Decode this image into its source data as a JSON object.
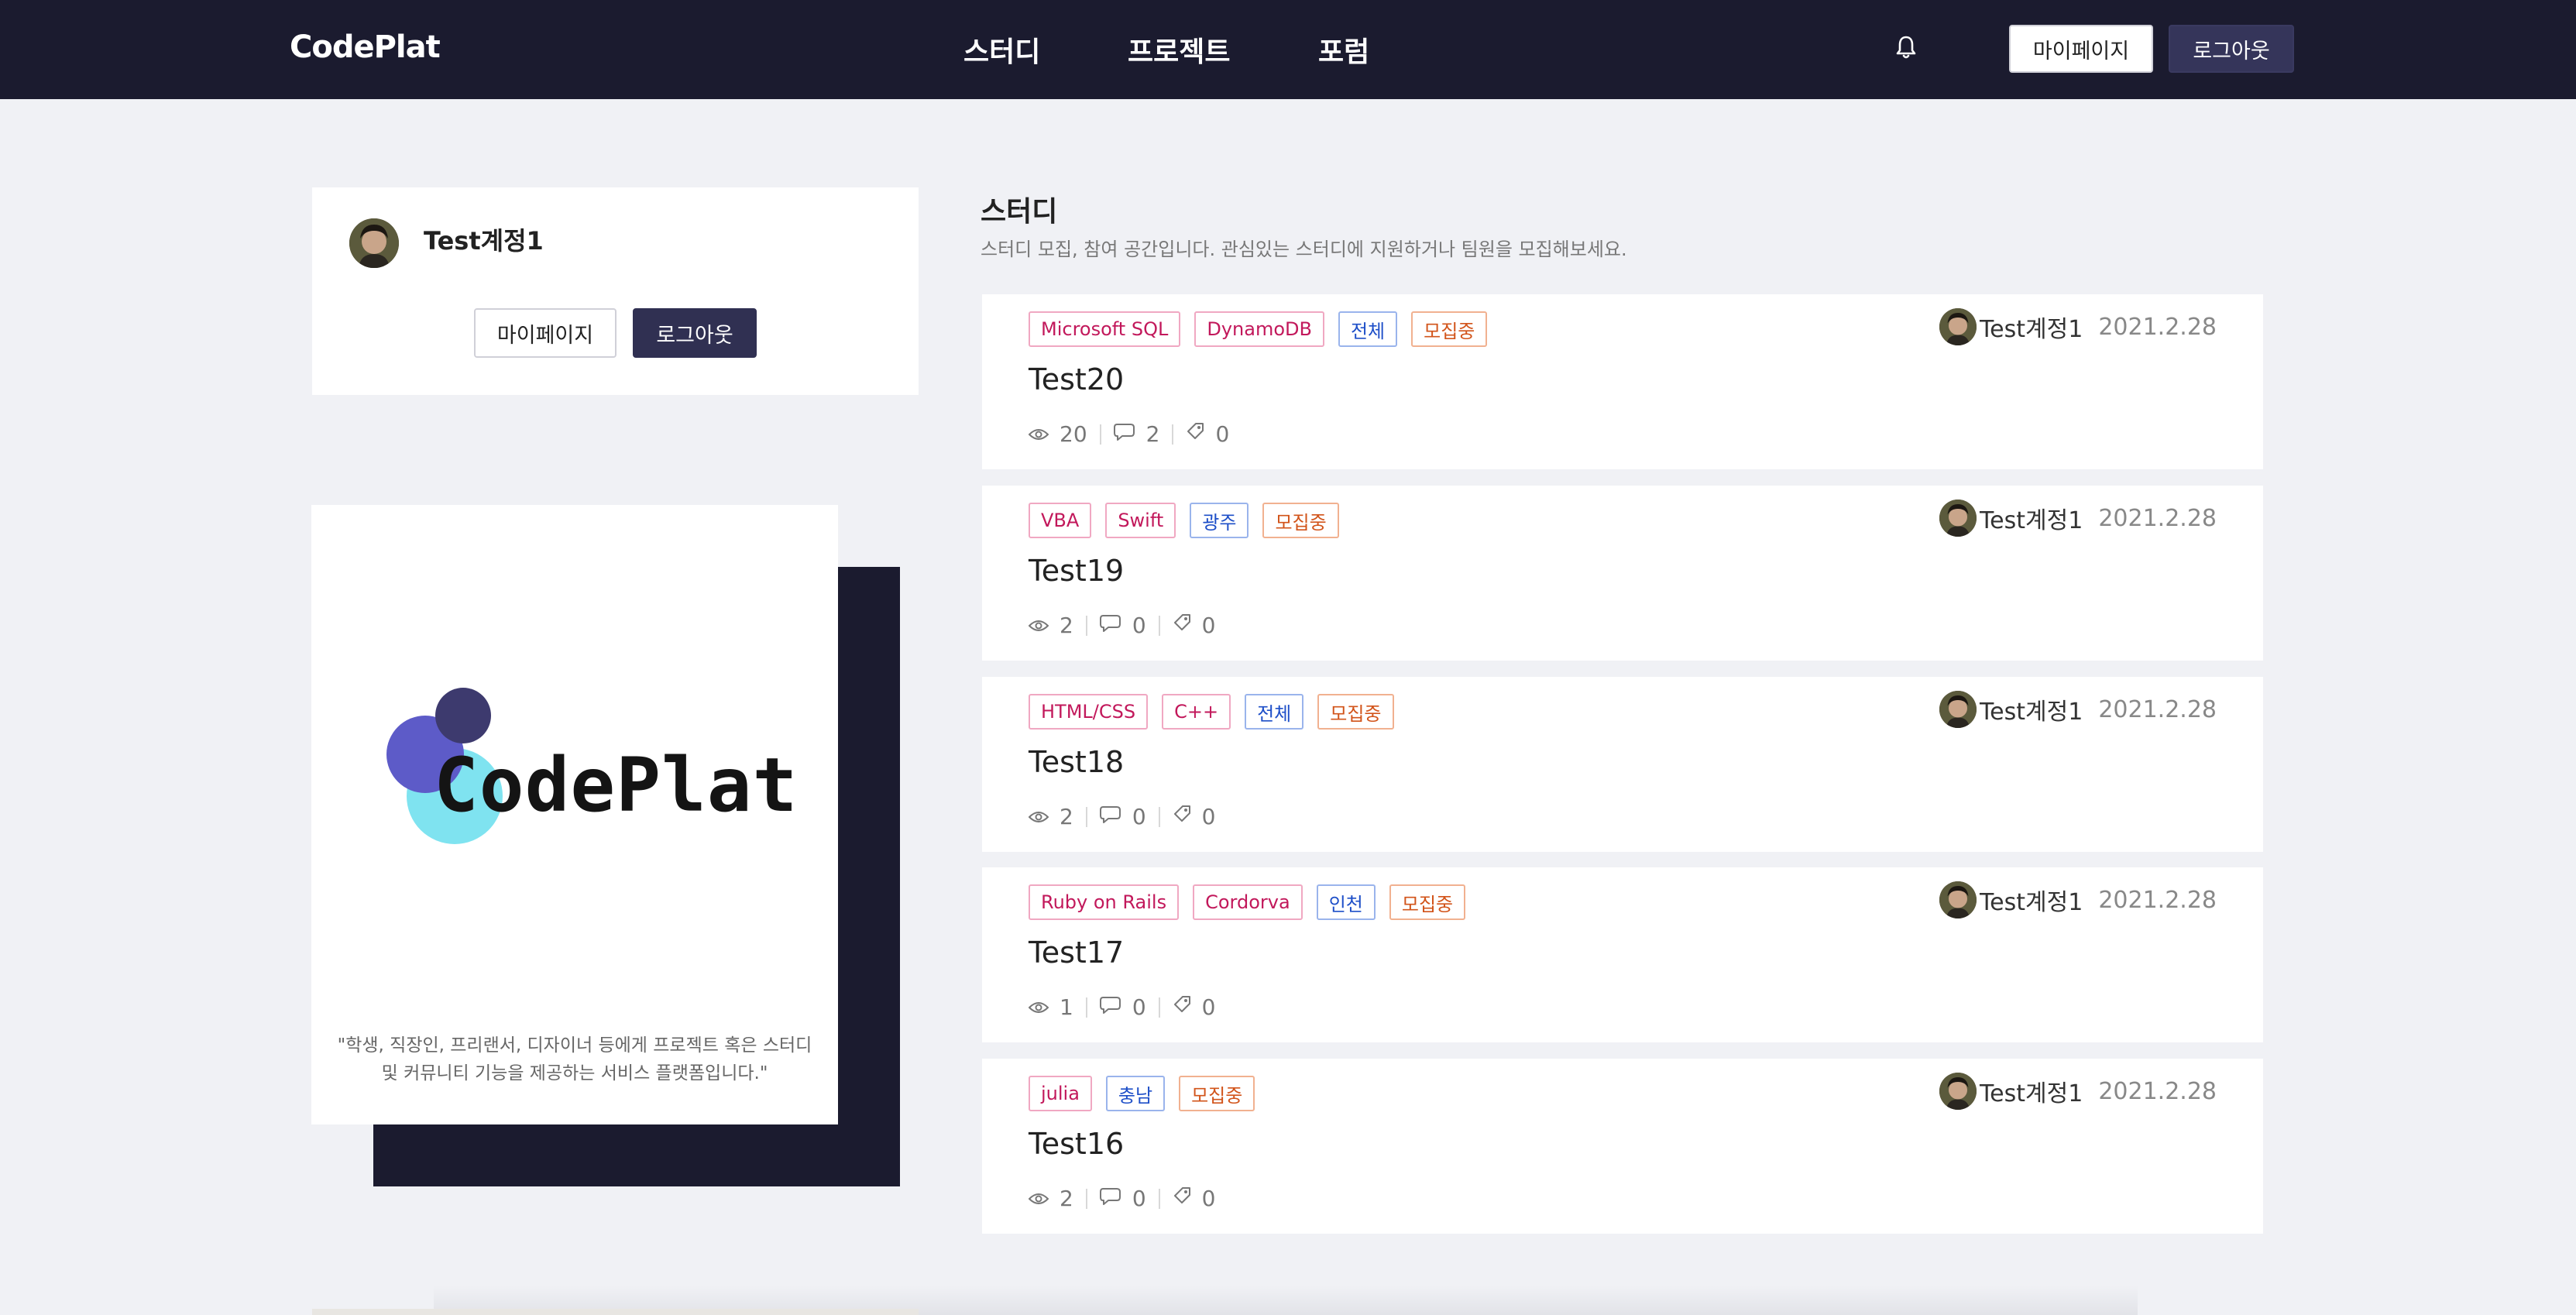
{
  "header": {
    "brand": "CodePlat",
    "nav": [
      "스터디",
      "프로젝트",
      "포럼"
    ],
    "mypage_label": "마이페이지",
    "logout_label": "로그아웃"
  },
  "profile": {
    "name": "Test계정1",
    "mypage_label": "마이페이지",
    "logout_label": "로그아웃"
  },
  "logo_card": {
    "wordmark": "CodePlat",
    "description_line1": "\"학생, 직장인, 프리랜서, 디자이너 등에게 프로젝트 혹은 스터디",
    "description_line2": "및 커뮤니티 기능을 제공하는 서비스 플랫폼입니다.\""
  },
  "section": {
    "title": "스터디",
    "description": "스터디 모집, 참여 공간입니다. 관심있는 스터디에 지원하거나 팀원을 모집해보세요."
  },
  "posts": [
    {
      "tech": [
        "Microsoft SQL",
        "DynamoDB"
      ],
      "location": "전체",
      "status": "모집중",
      "title": "Test20",
      "views": "20",
      "comments": "2",
      "likes": "0",
      "author": "Test계정1",
      "date": "2021.2.28"
    },
    {
      "tech": [
        "VBA",
        "Swift"
      ],
      "location": "광주",
      "status": "모집중",
      "title": "Test19",
      "views": "2",
      "comments": "0",
      "likes": "0",
      "author": "Test계정1",
      "date": "2021.2.28"
    },
    {
      "tech": [
        "HTML/CSS",
        "C++"
      ],
      "location": "전체",
      "status": "모집중",
      "title": "Test18",
      "views": "2",
      "comments": "0",
      "likes": "0",
      "author": "Test계정1",
      "date": "2021.2.28"
    },
    {
      "tech": [
        "Ruby on Rails",
        "Cordorva"
      ],
      "location": "인천",
      "status": "모집중",
      "title": "Test17",
      "views": "1",
      "comments": "0",
      "likes": "0",
      "author": "Test계정1",
      "date": "2021.2.28"
    },
    {
      "tech": [
        "julia"
      ],
      "location": "충남",
      "status": "모집중",
      "title": "Test16",
      "views": "2",
      "comments": "0",
      "likes": "0",
      "author": "Test계정1",
      "date": "2021.2.28"
    }
  ],
  "colors": {
    "header_bg": "#1b1b2f",
    "page_bg": "#f0f1f5",
    "logout_button": "#303052",
    "tag_tech": "#c2185b",
    "tag_location": "#1e4fc8",
    "tag_status": "#d2541a",
    "logo_circle_purple": "#5d5bc8",
    "logo_circle_dark": "#3d3a6e",
    "logo_circle_cyan": "#7fe3f0"
  }
}
